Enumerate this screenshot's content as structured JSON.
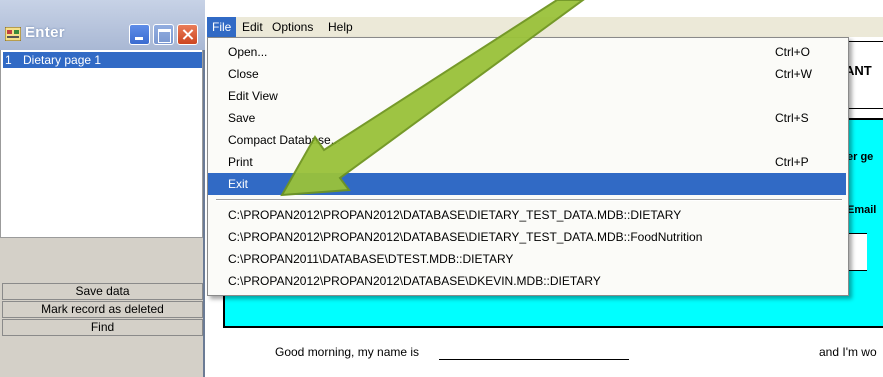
{
  "enter_window": {
    "title": "Enter",
    "records": [
      {
        "num": "1",
        "name": "Dietary page 1"
      }
    ],
    "buttons": {
      "save": "Save data",
      "mark_deleted": "Mark record as deleted",
      "find": "Find"
    }
  },
  "menubar": {
    "items": [
      "File",
      "Edit",
      "Options",
      "Help"
    ]
  },
  "file_menu": {
    "items": [
      {
        "label": "Open...",
        "shortcut": "Ctrl+O"
      },
      {
        "label": "Close",
        "shortcut": "Ctrl+W"
      },
      {
        "label": "Edit View",
        "shortcut": ""
      },
      {
        "label": "Save",
        "shortcut": "Ctrl+S"
      },
      {
        "label": "Compact Database...",
        "shortcut": ""
      },
      {
        "label": "Print",
        "shortcut": "Ctrl+P"
      },
      {
        "label": "Exit",
        "shortcut": "",
        "highlighted": true
      }
    ],
    "recent_files": [
      "C:\\PROPAN2012\\PROPAN2012\\DATABASE\\DIETARY_TEST_DATA.MDB::DIETARY",
      "C:\\PROPAN2012\\PROPAN2012\\DATABASE\\DIETARY_TEST_DATA.MDB::FoodNutrition",
      "C:\\PROPAN2011\\DATABASE\\DTEST.MDB::DIETARY",
      "C:\\PROPAN2012\\PROPAN2012\\DATABASE\\DKEVIN.MDB::DIETARY"
    ]
  },
  "background_form": {
    "header_fragment": "ANT",
    "label_1": "er ge",
    "label_2": "Email",
    "greeting": "Good morning, my name is",
    "greeting_end": "and I'm wo"
  },
  "colors": {
    "highlight": "#316ac5",
    "panel": "#00ffff",
    "arrow": "#9ac23a"
  }
}
